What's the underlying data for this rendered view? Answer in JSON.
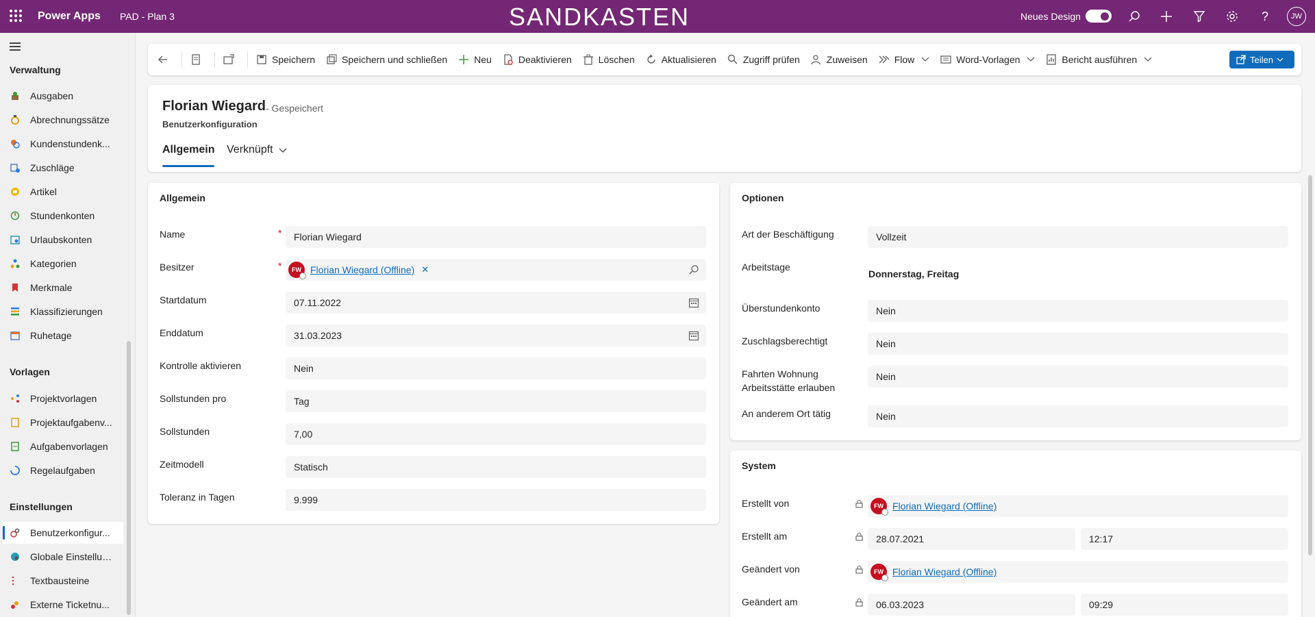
{
  "topbar": {
    "app_name": "Power Apps",
    "environment": "PAD - Plan 3",
    "banner": "SANDKASTEN",
    "new_design_label": "Neues Design",
    "new_design_on": true,
    "user_initials": "JW",
    "icons": [
      "search-icon",
      "add-icon",
      "filter-icon",
      "settings-icon",
      "help-icon"
    ]
  },
  "sidebar": {
    "groups": [
      {
        "title": "Verwaltung",
        "items": [
          {
            "label": "Ausgaben",
            "icon": "expense-icon"
          },
          {
            "label": "Abrechnungssätze",
            "icon": "rate-icon"
          },
          {
            "label": "Kundenstundenk...",
            "icon": "customer-hours-icon"
          },
          {
            "label": "Zuschläge",
            "icon": "surcharge-icon"
          },
          {
            "label": "Artikel",
            "icon": "article-icon"
          },
          {
            "label": "Stundenkonten",
            "icon": "hour-account-icon"
          },
          {
            "label": "Urlaubskonten",
            "icon": "vacation-account-icon"
          },
          {
            "label": "Kategorien",
            "icon": "category-icon"
          },
          {
            "label": "Merkmale",
            "icon": "tag-icon"
          },
          {
            "label": "Klassifizierungen",
            "icon": "classification-icon"
          },
          {
            "label": "Ruhetage",
            "icon": "calendar-icon"
          }
        ]
      },
      {
        "title": "Vorlagen",
        "items": [
          {
            "label": "Projektvorlagen",
            "icon": "project-template-icon"
          },
          {
            "label": "Projektaufgabenv...",
            "icon": "project-task-template-icon"
          },
          {
            "label": "Aufgabenvorlagen",
            "icon": "task-template-icon"
          },
          {
            "label": "Regelaufgaben",
            "icon": "recurring-task-icon"
          }
        ]
      },
      {
        "title": "Einstellungen",
        "items": [
          {
            "label": "Benutzerkonfigur...",
            "icon": "user-config-icon",
            "active": true
          },
          {
            "label": "Globale Einstellun...",
            "icon": "globe-icon"
          },
          {
            "label": "Textbausteine",
            "icon": "text-block-icon"
          },
          {
            "label": "Externe Ticketnu...",
            "icon": "external-ticket-icon"
          }
        ]
      }
    ]
  },
  "commandbar": {
    "save": "Speichern",
    "save_close": "Speichern und schließen",
    "new": "Neu",
    "deactivate": "Deaktivieren",
    "delete": "Löschen",
    "refresh": "Aktualisieren",
    "check_access": "Zugriff prüfen",
    "assign": "Zuweisen",
    "flow": "Flow",
    "word_templates": "Word-Vorlagen",
    "run_report": "Bericht ausführen",
    "share": "Teilen"
  },
  "header": {
    "title": "Florian Wiegard",
    "status": "- Gespeichert",
    "entity": "Benutzerkonfiguration",
    "tabs": [
      "Allgemein",
      "Verknüpft"
    ]
  },
  "general": {
    "title": "Allgemein",
    "name_label": "Name",
    "name_value": "Florian Wiegard",
    "owner_label": "Besitzer",
    "owner_initials": "FW",
    "owner_value": "Florian Wiegard (Offline)",
    "start_label": "Startdatum",
    "start_value": "07.11.2022",
    "end_label": "Enddatum",
    "end_value": "31.03.2023",
    "control_label": "Kontrolle aktivieren",
    "control_value": "Nein",
    "target_per_label": "Sollstunden pro",
    "target_per_value": "Tag",
    "target_hours_label": "Sollstunden",
    "target_hours_value": "7,00",
    "time_model_label": "Zeitmodell",
    "time_model_value": "Statisch",
    "tolerance_label": "Toleranz in Tagen",
    "tolerance_value": "9.999"
  },
  "options": {
    "title": "Optionen",
    "employment_label": "Art der Beschäftigung",
    "employment_value": "Vollzeit",
    "workdays_label": "Arbeitstage",
    "workdays_value": "Donnerstag, Freitag",
    "overtime_label": "Überstundenkonto",
    "overtime_value": "Nein",
    "surcharge_label": "Zuschlagsberechtigt",
    "surcharge_value": "Nein",
    "commute_label_1": "Fahrten Wohnung",
    "commute_label_2": "Arbeitsstätte erlauben",
    "commute_value": "Nein",
    "other_place_label": "An anderem Ort tätig",
    "other_place_value": "Nein"
  },
  "system": {
    "title": "System",
    "created_by_label": "Erstellt von",
    "created_by_initials": "FW",
    "created_by_value": "Florian Wiegard (Offline)",
    "created_on_label": "Erstellt am",
    "created_on_date": "28.07.2021",
    "created_on_time": "12:17",
    "modified_by_label": "Geändert von",
    "modified_by_initials": "FW",
    "modified_by_value": "Florian Wiegard (Offline)",
    "modified_on_label": "Geändert am",
    "modified_on_date": "06.03.2023",
    "modified_on_time": "09:29"
  }
}
